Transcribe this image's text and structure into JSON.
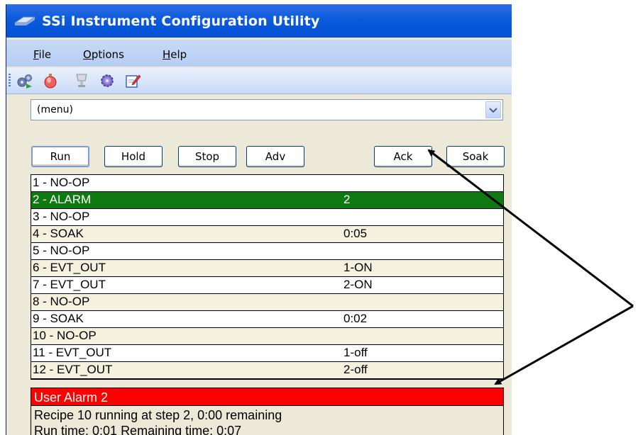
{
  "window": {
    "title": "SSi Instrument Configuration Utility"
  },
  "menubar": {
    "items": [
      {
        "underlined": "F",
        "rest": "ile"
      },
      {
        "underlined": "O",
        "rest": "ptions"
      },
      {
        "underlined": "H",
        "rest": "elp"
      }
    ]
  },
  "toolbar": {
    "icons": [
      "gears-play-icon",
      "alarm-bell-icon",
      "trophy-icon",
      "settings-gear-icon",
      "edit-document-icon"
    ]
  },
  "menu_select": {
    "value": "(menu)"
  },
  "buttons": {
    "run": "Run",
    "hold": "Hold",
    "stop": "Stop",
    "adv": "Adv",
    "ack": "Ack",
    "soak": "Soak"
  },
  "steps": [
    {
      "label": "1 - NO-OP",
      "value": ""
    },
    {
      "label": "2 - ALARM",
      "value": "2",
      "selected": true
    },
    {
      "label": "3 - NO-OP",
      "value": ""
    },
    {
      "label": "4 - SOAK",
      "value": "0:05"
    },
    {
      "label": "5 - NO-OP",
      "value": ""
    },
    {
      "label": "6 - EVT_OUT",
      "value": "1-ON"
    },
    {
      "label": "7 - EVT_OUT",
      "value": "2-ON"
    },
    {
      "label": "8 - NO-OP",
      "value": ""
    },
    {
      "label": "9 - SOAK",
      "value": "0:02"
    },
    {
      "label": "10 - NO-OP",
      "value": ""
    },
    {
      "label": "11 - EVT_OUT",
      "value": "1-off"
    },
    {
      "label": "12 - EVT_OUT",
      "value": "2-off"
    }
  ],
  "alarm": {
    "text": "User Alarm 2",
    "color": "#ff0000"
  },
  "status": {
    "line1": "Recipe 10 running at step 2, 0:00 remaining",
    "line2": "Run time: 0:01 Remaining time: 0:07"
  },
  "colors": {
    "selected_row": "#0f7a12",
    "alarm": "#ff0000",
    "titlebar": "#0a5bdc"
  }
}
